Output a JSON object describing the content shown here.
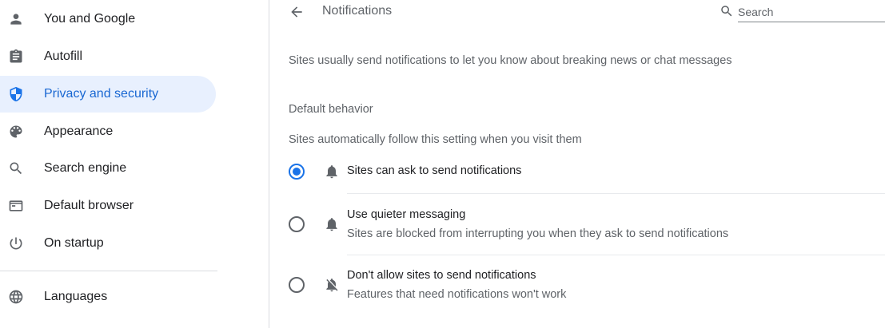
{
  "sidebar": {
    "items": [
      {
        "label": "You and Google",
        "icon": "person-icon"
      },
      {
        "label": "Autofill",
        "icon": "clipboard-icon"
      },
      {
        "label": "Privacy and security",
        "icon": "shield-icon",
        "active": true
      },
      {
        "label": "Appearance",
        "icon": "palette-icon"
      },
      {
        "label": "Search engine",
        "icon": "search-icon"
      },
      {
        "label": "Default browser",
        "icon": "browser-window-icon"
      },
      {
        "label": "On startup",
        "icon": "power-icon"
      },
      {
        "label": "Languages",
        "icon": "globe-icon"
      }
    ]
  },
  "header": {
    "title": "Notifications",
    "search_placeholder": "Search"
  },
  "main": {
    "description": "Sites usually send notifications to let you know about breaking news or chat messages",
    "default_behavior": {
      "heading": "Default behavior",
      "subtitle": "Sites automatically follow this setting when you visit them",
      "options": [
        {
          "label": "Sites can ask to send notifications",
          "sublabel": "",
          "icon": "bell-icon",
          "selected": true
        },
        {
          "label": "Use quieter messaging",
          "sublabel": "Sites are blocked from interrupting you when they ask to send notifications",
          "icon": "bell-icon",
          "selected": false
        },
        {
          "label": "Don't allow sites to send notifications",
          "sublabel": "Features that need notifications won't work",
          "icon": "bell-off-icon",
          "selected": false
        }
      ]
    }
  },
  "colors": {
    "accent": "#1a73e8",
    "active_bg": "#e8f0fe",
    "secondary_text": "#5f6368"
  }
}
